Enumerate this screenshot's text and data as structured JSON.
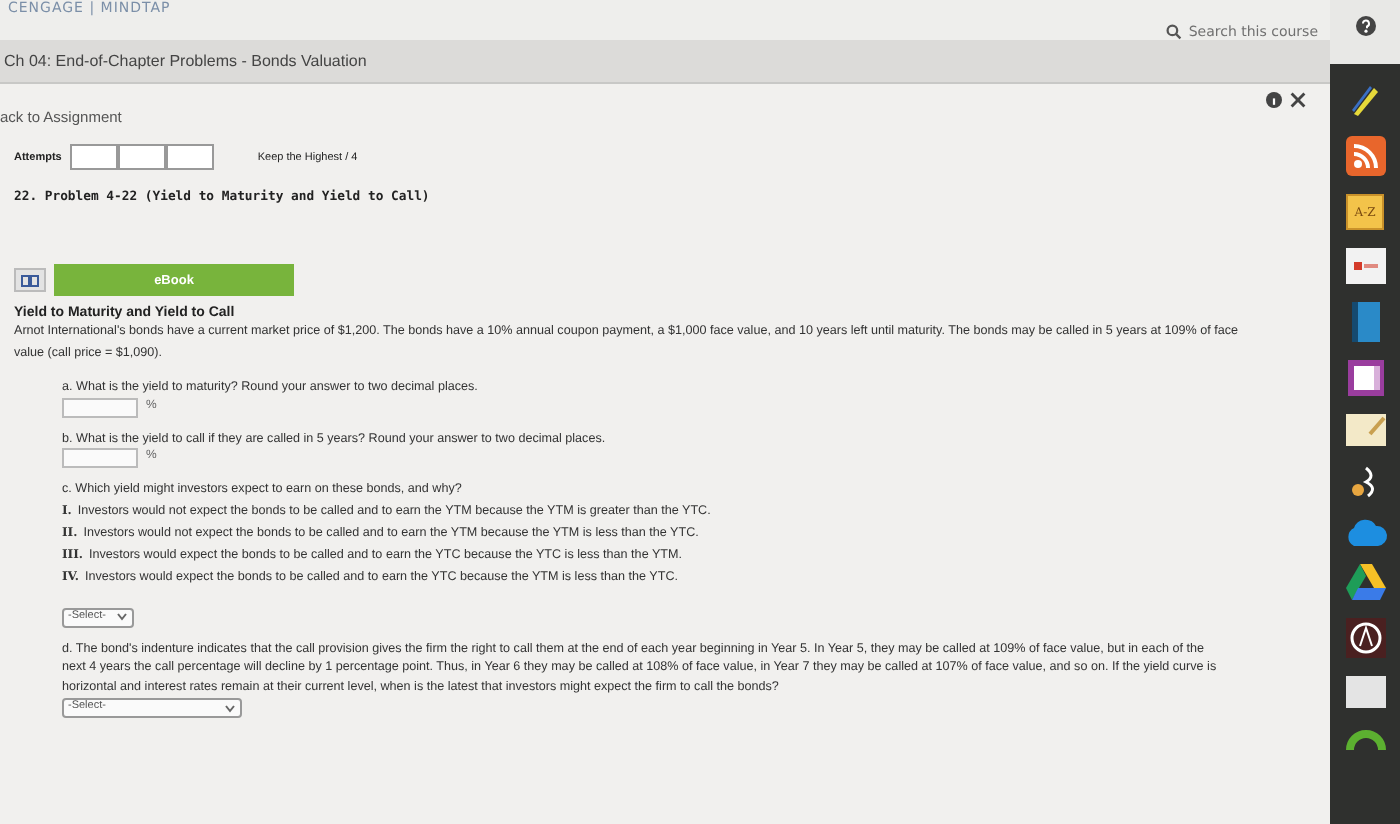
{
  "brand": "CENGAGE | MINDTAP",
  "search": {
    "placeholder": "Search this course"
  },
  "title": "Ch 04: End-of-Chapter Problems - Bonds Valuation",
  "back_link": "ack to Assignment",
  "attempts": {
    "label": "Attempts",
    "keep": "Keep the Highest / 4"
  },
  "problem_title": "22. Problem 4-22 (Yield to Maturity and Yield to Call)",
  "ebook": "eBook",
  "heading": "Yield to Maturity and Yield to Call",
  "intro": "Arnot International's bonds have a current market price of $1,200. The bonds have a 10% annual coupon payment, a $1,000 face value, and 10 years left until maturity. The bonds may be called in 5 years at 109% of face value (call price = $1,090).",
  "questions": [
    {
      "kind": "input",
      "label": "a. What is the yield to maturity? Round your answer to two decimal places.",
      "unit": "%"
    },
    {
      "kind": "input",
      "label": "b. What is the yield to call if they are called in 5 years? Round your answer to two decimal places.",
      "unit": "%"
    },
    {
      "kind": "choice",
      "label": "c. Which yield might investors expect to earn on these bonds, and why?",
      "options": [
        {
          "numeral": "I.",
          "text": "Investors would not expect the bonds to be called and to earn the YTM because the YTM is greater than the YTC."
        },
        {
          "numeral": "II.",
          "text": "Investors would not expect the bonds to be called and to earn the YTM because the YTM is less than the YTC."
        },
        {
          "numeral": "III.",
          "text": "Investors would expect the bonds to be called and to earn the YTC because the YTC is less than the YTM."
        },
        {
          "numeral": "IV.",
          "text": "Investors would expect the bonds to be called and to earn the YTC because the YTM is less than the YTC."
        }
      ],
      "select": "-Select-"
    },
    {
      "kind": "select",
      "label": "d. The bond's indenture indicates that the call provision gives the firm the right to call them at the end of each year beginning in Year 5. In Year 5, they may be called at 109% of face value, but in each of the next 4 years the call percentage will decline by 1 percentage point. Thus, in Year 6 they may be called at 108% of face value, in Year 7 they may be called at 107% of face value, and so on. If the yield curve is horizontal and interest rates remain at their current level, when is the latest that investors might expect the firm to call the bonds?",
      "select": "-Select-"
    }
  ],
  "dock": [
    {
      "kind": "pencil"
    },
    {
      "kind": "rss"
    },
    {
      "kind": "az",
      "label": "A-Z"
    },
    {
      "kind": "office"
    },
    {
      "kind": "book"
    },
    {
      "kind": "onenote"
    },
    {
      "kind": "notepad"
    },
    {
      "kind": "music"
    },
    {
      "kind": "cloud"
    },
    {
      "kind": "drive"
    },
    {
      "kind": "aplus"
    },
    {
      "kind": "window"
    },
    {
      "kind": "ring"
    }
  ]
}
